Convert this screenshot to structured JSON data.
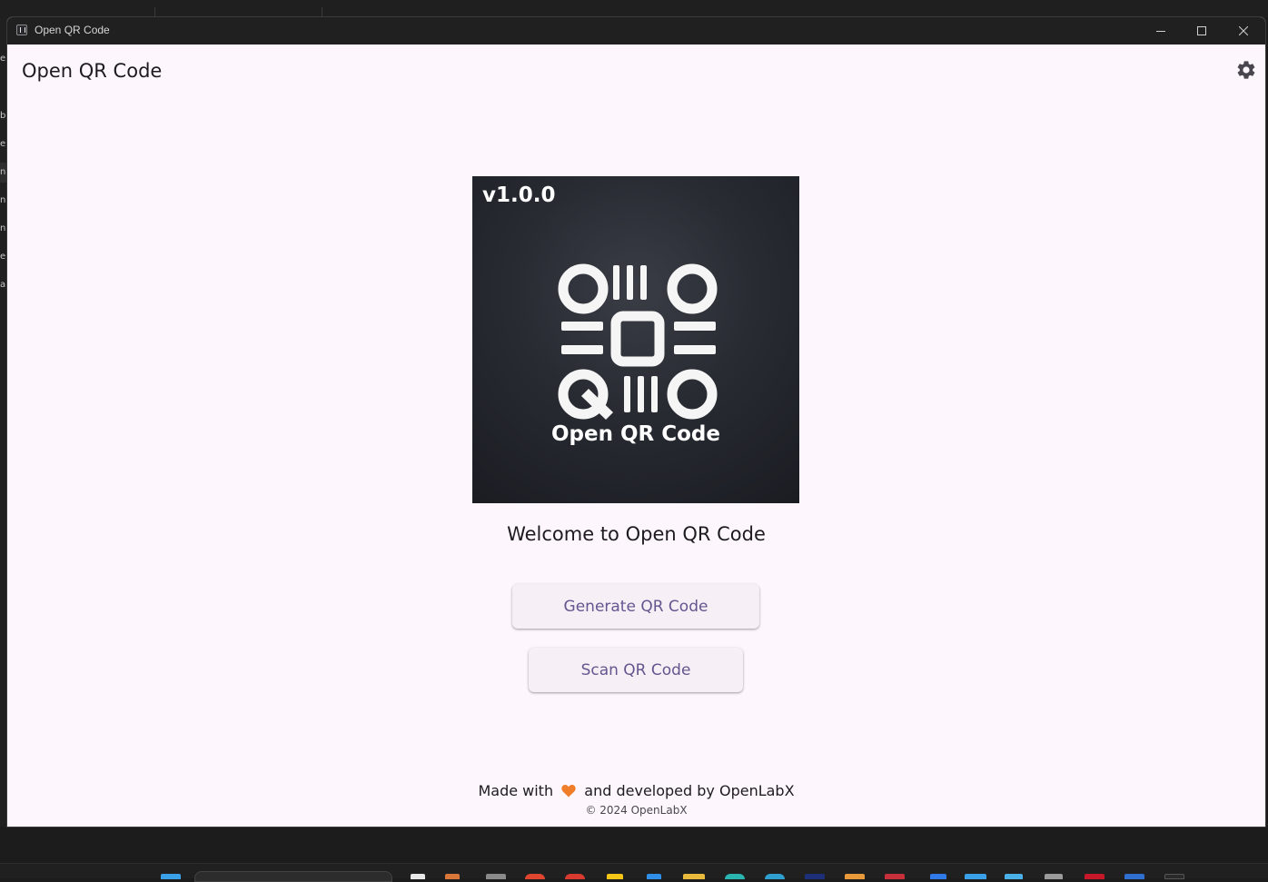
{
  "window": {
    "title": "Open QR Code"
  },
  "app_bar": {
    "title": "Open QR Code",
    "settings_icon": "gear-icon"
  },
  "logo": {
    "version": "v1.0.0",
    "brand": "Open QR Code"
  },
  "main": {
    "welcome": "Welcome to Open QR Code",
    "generate_label": "Generate QR Code",
    "scan_label": "Scan QR Code"
  },
  "footer": {
    "made_with": "Made with",
    "developed_by": "and developed by OpenLabX",
    "copyright": "© 2024 OpenLabX"
  },
  "background": {
    "left_fragments": [
      "e",
      "",
      "ba",
      "e",
      "n",
      "n",
      "n",
      "e",
      "a"
    ]
  },
  "colors": {
    "accent": "#65558f",
    "surface": "#fdf7fd",
    "button": "#f6f0f6",
    "heart": "#f07d2a"
  }
}
